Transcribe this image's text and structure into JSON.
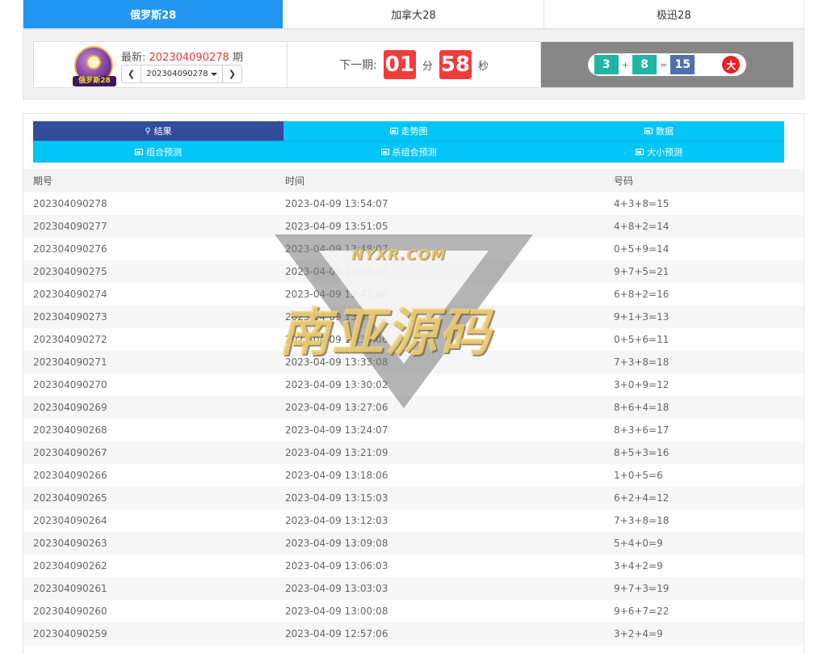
{
  "top_tabs": [
    {
      "label": "俄罗斯28",
      "active": true
    },
    {
      "label": "加拿大28",
      "active": false
    },
    {
      "label": "极迅28",
      "active": false
    }
  ],
  "header": {
    "logo_text": "俄罗斯28",
    "latest_prefix": "最新:",
    "latest_period": "202304090278",
    "latest_suffix": "期",
    "period_select": "202304090278",
    "prev_icon": "chevron-left-icon",
    "next_icon": "chevron-right-icon",
    "next_label": "下一期:",
    "minutes": "01",
    "minutes_unit": "分",
    "seconds": "58",
    "seconds_unit": "秒",
    "result": {
      "n1": "3",
      "plus": "+",
      "n2": "8",
      "equals": "=",
      "sum": "15",
      "size": "大"
    }
  },
  "sub_tabs": {
    "row1": [
      {
        "label": "结果",
        "icon": "key-icon",
        "active": true
      },
      {
        "label": "走势图",
        "icon": "image-icon",
        "active": false
      },
      {
        "label": "数据",
        "icon": "image-icon",
        "active": false
      }
    ],
    "row2": [
      {
        "label": "组合预测",
        "icon": "image-icon",
        "active": false
      },
      {
        "label": "杀组合预测",
        "icon": "image-icon",
        "active": false
      },
      {
        "label": "大小预测",
        "icon": "image-icon",
        "active": false
      }
    ]
  },
  "table": {
    "headers": [
      "期号",
      "时间",
      "号码"
    ],
    "rows": [
      [
        "202304090278",
        "2023-04-09 13:54:07",
        "4+3+8=15"
      ],
      [
        "202304090277",
        "2023-04-09 13:51:05",
        "4+8+2=14"
      ],
      [
        "202304090276",
        "2023-04-09 13:48:07",
        "0+5+9=14"
      ],
      [
        "202304090275",
        "2023-04-09 13:45:07",
        "9+7+5=21"
      ],
      [
        "202304090274",
        "2023-04-09 13:42:06",
        "6+8+2=16"
      ],
      [
        "202304090273",
        "2023-04-09 13:39:02",
        "9+1+3=13"
      ],
      [
        "202304090272",
        "2023-04-09 13:36:06",
        "0+5+6=11"
      ],
      [
        "202304090271",
        "2023-04-09 13:33:08",
        "7+3+8=18"
      ],
      [
        "202304090270",
        "2023-04-09 13:30:02",
        "3+0+9=12"
      ],
      [
        "202304090269",
        "2023-04-09 13:27:06",
        "8+6+4=18"
      ],
      [
        "202304090268",
        "2023-04-09 13:24:07",
        "8+3+6=17"
      ],
      [
        "202304090267",
        "2023-04-09 13:21:09",
        "8+5+3=16"
      ],
      [
        "202304090266",
        "2023-04-09 13:18:06",
        "1+0+5=6"
      ],
      [
        "202304090265",
        "2023-04-09 13:15:03",
        "6+2+4=12"
      ],
      [
        "202304090264",
        "2023-04-09 13:12:03",
        "7+3+8=18"
      ],
      [
        "202304090263",
        "2023-04-09 13:09:08",
        "5+4+0=9"
      ],
      [
        "202304090262",
        "2023-04-09 13:06:03",
        "3+4+2=9"
      ],
      [
        "202304090261",
        "2023-04-09 13:03:03",
        "9+7+3=19"
      ],
      [
        "202304090260",
        "2023-04-09 13:00:08",
        "9+6+7=22"
      ],
      [
        "202304090259",
        "2023-04-09 12:57:06",
        "3+2+4=9"
      ]
    ]
  },
  "watermark": {
    "site": "NYXR.COM",
    "title": "南亚源码"
  },
  "colors": {
    "active_tab": "#2196f3",
    "sub_tab": "#03c6f8",
    "sub_tab_active": "#344c9c",
    "countdown": "#f23c3c",
    "latest_period": "#e53935"
  }
}
